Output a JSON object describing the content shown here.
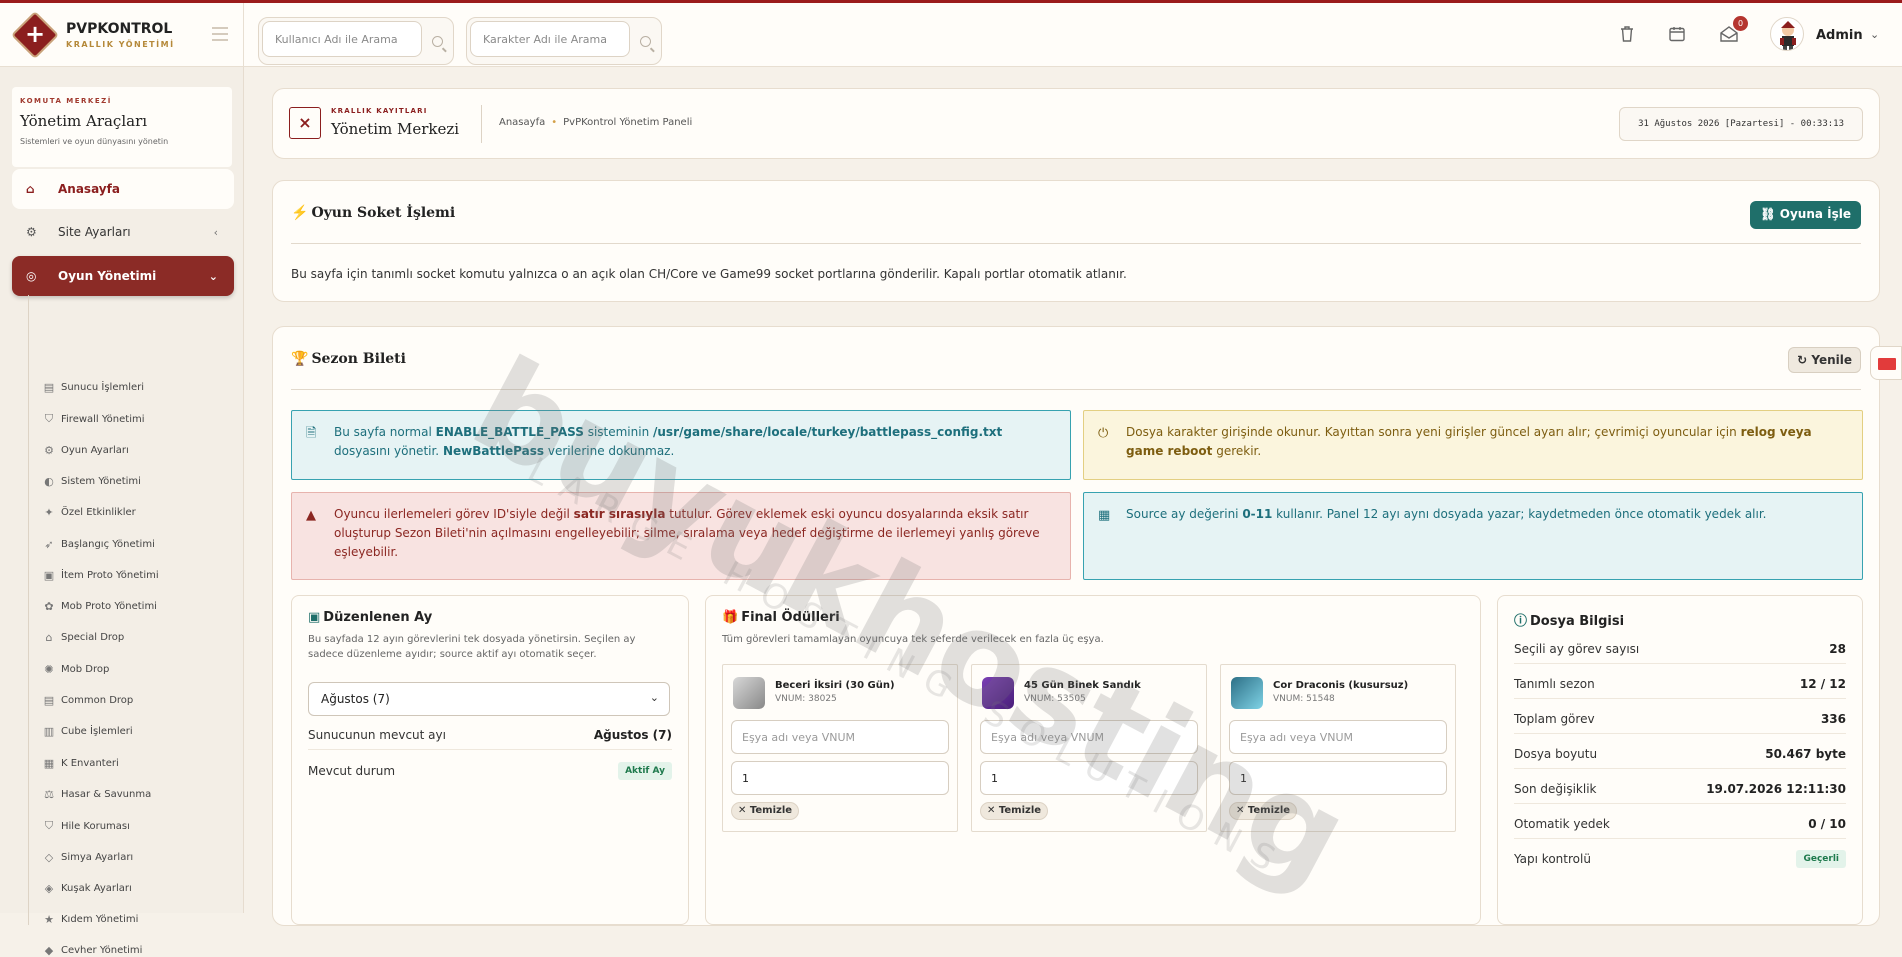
{
  "brand": {
    "name": "PVPKONTROL",
    "sub": "KRALLIK YÖNETİMİ"
  },
  "header": {
    "search_user_placeholder": "Kullanıcı Adı ile Arama",
    "search_char_placeholder": "Karakter Adı ile Arama",
    "mail_badge": "0",
    "user": "Admin"
  },
  "sidebar": {
    "kicker": "KOMUTA MERKEZİ",
    "title": "Yönetim Araçları",
    "subtitle": "Sistemleri ve oyun dünyasını yönetin",
    "nav": [
      {
        "label": "Anasayfa",
        "icon": "home-icon"
      },
      {
        "label": "Site Ayarları",
        "icon": "gear-icon"
      },
      {
        "label": "Oyun Yönetimi",
        "icon": "gamepad-icon"
      }
    ],
    "sub": [
      "Sunucu İşlemleri",
      "Firewall Yönetimi",
      "Oyun Ayarları",
      "Sistem Yönetimi",
      "Özel Etkinlikler",
      "Başlangıç Yönetimi",
      "İtem Proto Yönetimi",
      "Mob Proto Yönetimi",
      "Special Drop",
      "Mob Drop",
      "Common Drop",
      "Cube İşlemleri",
      "K Envanteri",
      "Hasar & Savunma",
      "Hile Koruması",
      "Simya Ayarları",
      "Kuşak Ayarları",
      "Kıdem Yönetimi",
      "Cevher Yönetimi"
    ]
  },
  "pageheader": {
    "kicker": "KRALLIK KAYITLARI",
    "title": "Yönetim Merkezi",
    "crumb_home": "Anasayfa",
    "crumb_current": "PvPKontrol Yönetim Paneli",
    "datetime": "31 Ağustos 2026 [Pazartesi] - 00:33:13"
  },
  "socket": {
    "title": "Oyun Soket İşlemi",
    "button": "Oyuna İşle",
    "text": "Bu sayfa için tanımlı socket komutu yalnızca o an açık olan CH/Core ve Game99 socket portlarına gönderilir. Kapalı portlar otomatik atlanır."
  },
  "season": {
    "title": "Sezon Bileti",
    "refresh": "Yenile",
    "info1": {
      "a": "Bu sayfa normal ",
      "b": "ENABLE_BATTLE_PASS",
      "c": " sisteminin ",
      "d": "/usr/game/share/locale/turkey/battlepass_config.txt",
      "e": " dosyasını yönetir. ",
      "f": "NewBattlePass",
      "g": " verilerine dokunmaz."
    },
    "warn": {
      "a": "Dosya karakter girişinde okunur. Kayıttan sonra yeni girişler güncel ayarı alır; çevrimiçi oyuncular için ",
      "b": "relog veya game reboot",
      "c": " gerekir."
    },
    "err": {
      "a": "Oyuncu ilerlemeleri görev ID'siyle değil ",
      "b": "satır sırasıyla",
      "c": " tutulur. Görev eklemek eski oyuncu dosyalarında eksik satır oluşturup Sezon Bileti'nin açılmasını engelleyebilir; silme, sıralama veya hedef değiştirme de ilerlemeyi yanlış göreve eşleyebilir."
    },
    "info2": {
      "a": "Source ay değerini ",
      "b": "0-11",
      "c": " kullanır. Panel 12 ayı aynı dosyada yazar; kaydetmeden önce otomatik yedek alır."
    }
  },
  "month": {
    "title": "Düzenlenen Ay",
    "desc": "Bu sayfada 12 ayın görevlerini tek dosyada yönetirsin. Seçilen ay sadece düzenleme ayıdır; source aktif ayı otomatik seçer.",
    "selected": "Ağustos (7)",
    "server_month_label": "Sunucunun mevcut ayı",
    "server_month_value": "Ağustos (7)",
    "status_label": "Mevcut durum",
    "status_value": "Aktif Ay"
  },
  "rewards": {
    "title": "Final Ödülleri",
    "desc": "Tüm görevleri tamamlayan oyuncuya tek seferde verilecek en fazla üç eşya.",
    "input_placeholder": "Eşya adı veya VNUM",
    "clear_label": "Temizle",
    "items": [
      {
        "name": "Beceri İksiri (30 Gün)",
        "vnum": "VNUM: 38025",
        "qty": "1"
      },
      {
        "name": "45 Gün Binek Sandık",
        "vnum": "VNUM: 53505",
        "qty": "1"
      },
      {
        "name": "Cor Draconis (kusursuz)",
        "vnum": "VNUM: 51548",
        "qty": "1"
      }
    ]
  },
  "fileinfo": {
    "title": "Dosya Bilgisi",
    "rows": [
      {
        "k": "Seçili ay görev sayısı",
        "v": "28"
      },
      {
        "k": "Tanımlı sezon",
        "v": "12 / 12"
      },
      {
        "k": "Toplam görev",
        "v": "336"
      },
      {
        "k": "Dosya boyutu",
        "v": "50.467 byte"
      },
      {
        "k": "Son değişiklik",
        "v": "19.07.2026 12:11:30"
      },
      {
        "k": "Otomatik yedek",
        "v": "0 / 10"
      }
    ],
    "check_label": "Yapı kontrolü",
    "check_value": "Geçerli"
  },
  "watermark": {
    "main": "buyukhosting",
    "sub": "LARGE HOSTING SOLUTIONS"
  },
  "colors": {
    "brand": "#8b1e1e",
    "teal": "#1f6f6a",
    "gold": "#b5893a"
  }
}
